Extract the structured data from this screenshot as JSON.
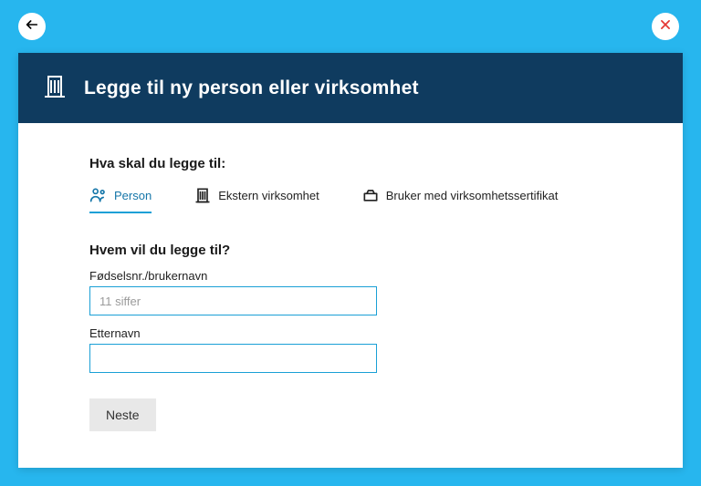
{
  "header": {
    "title": "Legge til ny person eller virksomhet"
  },
  "typeSection": {
    "label": "Hva skal du legge til:",
    "tabs": {
      "person": "Person",
      "ekstern": "Ekstern virksomhet",
      "bruker": "Bruker med virksomhetssertifikat"
    }
  },
  "form": {
    "heading": "Hvem vil du legge til?",
    "field1": {
      "label": "Fødselsnr./brukernavn",
      "placeholder": "11 siffer"
    },
    "field2": {
      "label": "Etternavn"
    },
    "nextLabel": "Neste"
  }
}
